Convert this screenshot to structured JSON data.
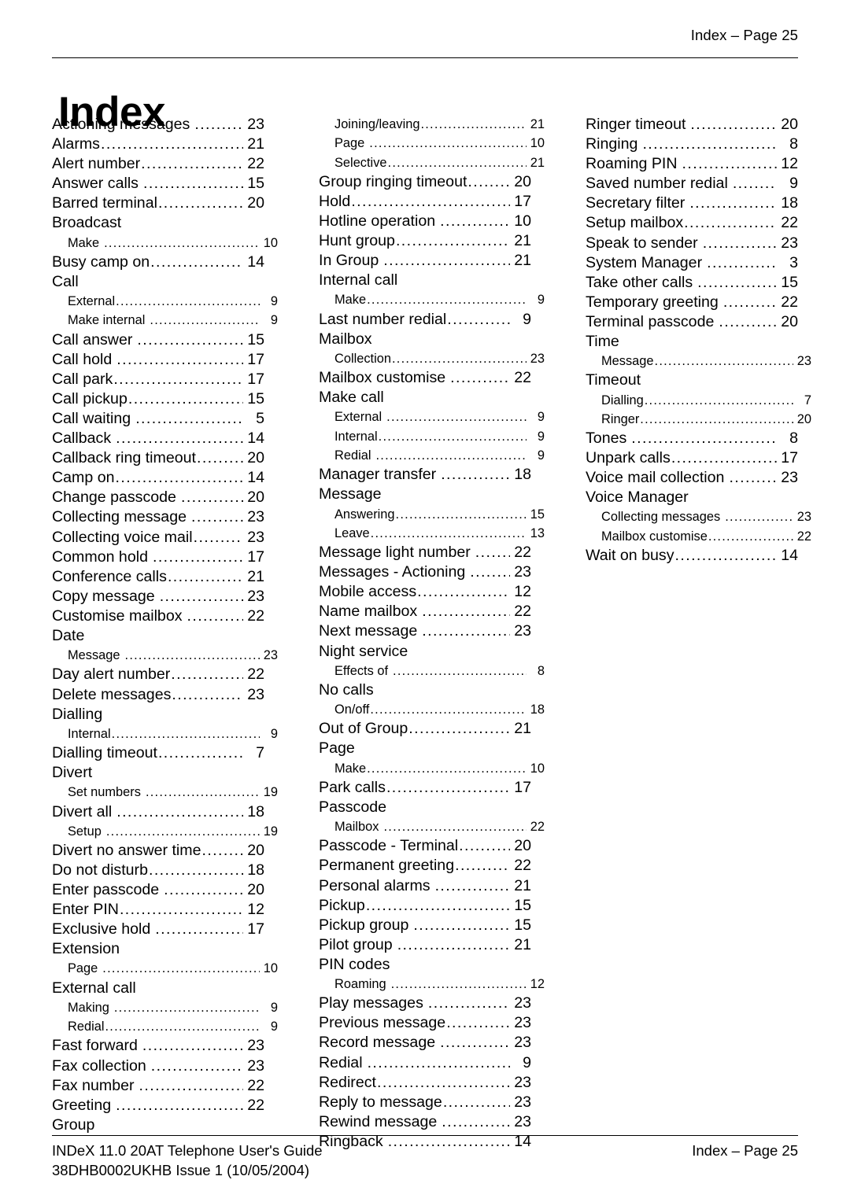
{
  "header": {
    "right_text": "Index – Page 25"
  },
  "title": "Index",
  "footer": {
    "line1": "INDeX 11.0 20AT Telephone User's Guide",
    "line2": "38DHB0002UKHB Issue 1 (10/05/2004)",
    "right_text": "Index – Page 25"
  },
  "columns": [
    {
      "name": "column-1",
      "entries": [
        {
          "label": "Actioning messages",
          "page": "23",
          "level": "main",
          "spaced": true
        },
        {
          "label": "Alarms",
          "page": "21",
          "level": "main",
          "spaced": false
        },
        {
          "label": "Alert number",
          "page": "22",
          "level": "main",
          "spaced": false
        },
        {
          "label": "Answer calls",
          "page": "15",
          "level": "main",
          "spaced": true
        },
        {
          "label": "Barred terminal",
          "page": "20",
          "level": "main",
          "spaced": false
        },
        {
          "label": "Broadcast",
          "page": "",
          "level": "heading",
          "spaced": false
        },
        {
          "label": "Make",
          "page": "10",
          "level": "sub",
          "spaced": true
        },
        {
          "label": "Busy camp on",
          "page": "14",
          "level": "main",
          "spaced": false
        },
        {
          "label": "Call",
          "page": "",
          "level": "heading",
          "spaced": false
        },
        {
          "label": "External",
          "page": "9",
          "level": "sub",
          "spaced": false
        },
        {
          "label": "Make internal",
          "page": "9",
          "level": "sub",
          "spaced": true
        },
        {
          "label": "Call answer",
          "page": "15",
          "level": "main",
          "spaced": true
        },
        {
          "label": "Call hold",
          "page": "17",
          "level": "main",
          "spaced": true
        },
        {
          "label": "Call park",
          "page": "17",
          "level": "main",
          "spaced": false
        },
        {
          "label": "Call pickup",
          "page": "15",
          "level": "main",
          "spaced": false
        },
        {
          "label": "Call waiting",
          "page": "5",
          "level": "main",
          "spaced": true
        },
        {
          "label": "Callback",
          "page": "14",
          "level": "main",
          "spaced": true
        },
        {
          "label": "Callback ring timeout",
          "page": "20",
          "level": "main",
          "spaced": false
        },
        {
          "label": "Camp on",
          "page": "14",
          "level": "main",
          "spaced": false
        },
        {
          "label": "Change passcode",
          "page": "20",
          "level": "main",
          "spaced": true
        },
        {
          "label": "Collecting message",
          "page": "23",
          "level": "main",
          "spaced": true
        },
        {
          "label": "Collecting voice mail",
          "page": "23",
          "level": "main",
          "spaced": false
        },
        {
          "label": "Common hold",
          "page": "17",
          "level": "main",
          "spaced": true
        },
        {
          "label": "Conference calls",
          "page": "21",
          "level": "main",
          "spaced": false
        },
        {
          "label": "Copy message",
          "page": "23",
          "level": "main",
          "spaced": true
        },
        {
          "label": "Customise mailbox",
          "page": "22",
          "level": "main",
          "spaced": true
        },
        {
          "label": "Date",
          "page": "",
          "level": "heading",
          "spaced": false
        },
        {
          "label": "Message",
          "page": "23",
          "level": "sub",
          "spaced": true
        },
        {
          "label": "Day alert number",
          "page": "22",
          "level": "main",
          "spaced": false
        },
        {
          "label": "Delete messages",
          "page": "23",
          "level": "main",
          "spaced": false
        },
        {
          "label": "Dialling",
          "page": "",
          "level": "heading",
          "spaced": false
        },
        {
          "label": "Internal",
          "page": "9",
          "level": "sub",
          "spaced": false
        },
        {
          "label": "Dialling timeout",
          "page": "7",
          "level": "main",
          "spaced": false
        },
        {
          "label": "Divert",
          "page": "",
          "level": "heading",
          "spaced": false
        },
        {
          "label": "Set numbers",
          "page": "19",
          "level": "sub",
          "spaced": true
        },
        {
          "label": "Divert all",
          "page": "18",
          "level": "main",
          "spaced": true
        },
        {
          "label": "Setup",
          "page": "19",
          "level": "sub",
          "spaced": true
        },
        {
          "label": "Divert no answer time",
          "page": "20",
          "level": "main",
          "spaced": false
        },
        {
          "label": "Do not disturb",
          "page": "18",
          "level": "main",
          "spaced": false
        },
        {
          "label": "Enter passcode",
          "page": "20",
          "level": "main",
          "spaced": true
        },
        {
          "label": "Enter PIN",
          "page": "12",
          "level": "main",
          "spaced": false
        },
        {
          "label": "Exclusive hold",
          "page": "17",
          "level": "main",
          "spaced": true
        },
        {
          "label": "Extension",
          "page": "",
          "level": "heading",
          "spaced": false
        },
        {
          "label": "Page",
          "page": "10",
          "level": "sub",
          "spaced": true
        },
        {
          "label": "External call",
          "page": "",
          "level": "heading",
          "spaced": false
        },
        {
          "label": "Making",
          "page": "9",
          "level": "sub",
          "spaced": true
        },
        {
          "label": "Redial",
          "page": "9",
          "level": "sub",
          "spaced": false
        },
        {
          "label": "Fast forward",
          "page": "23",
          "level": "main",
          "spaced": true
        },
        {
          "label": "Fax collection",
          "page": "23",
          "level": "main",
          "spaced": true
        },
        {
          "label": "Fax number",
          "page": "22",
          "level": "main",
          "spaced": true
        },
        {
          "label": "Greeting",
          "page": "22",
          "level": "main",
          "spaced": true
        },
        {
          "label": "Group",
          "page": "",
          "level": "heading",
          "spaced": false
        }
      ]
    },
    {
      "name": "column-2",
      "entries": [
        {
          "label": "Joining/leaving",
          "page": "21",
          "level": "sub",
          "spaced": false
        },
        {
          "label": "Page",
          "page": "10",
          "level": "sub",
          "spaced": true
        },
        {
          "label": "Selective",
          "page": "21",
          "level": "sub",
          "spaced": false
        },
        {
          "label": "Group ringing timeout",
          "page": "20",
          "level": "main",
          "spaced": false
        },
        {
          "label": "Hold",
          "page": "17",
          "level": "main",
          "spaced": false
        },
        {
          "label": "Hotline operation",
          "page": "10",
          "level": "main",
          "spaced": true
        },
        {
          "label": "Hunt group",
          "page": "21",
          "level": "main",
          "spaced": false
        },
        {
          "label": "In Group",
          "page": "21",
          "level": "main",
          "spaced": true
        },
        {
          "label": "Internal call",
          "page": "",
          "level": "heading",
          "spaced": false
        },
        {
          "label": "Make",
          "page": "9",
          "level": "sub",
          "spaced": false
        },
        {
          "label": "Last number redial",
          "page": "9",
          "level": "main",
          "spaced": false
        },
        {
          "label": "Mailbox",
          "page": "",
          "level": "heading",
          "spaced": false
        },
        {
          "label": "Collection",
          "page": "23",
          "level": "sub",
          "spaced": false
        },
        {
          "label": "Mailbox customise",
          "page": "22",
          "level": "main",
          "spaced": true
        },
        {
          "label": "Make call",
          "page": "",
          "level": "heading",
          "spaced": false
        },
        {
          "label": "External",
          "page": "9",
          "level": "sub",
          "spaced": true
        },
        {
          "label": "Internal",
          "page": "9",
          "level": "sub",
          "spaced": false
        },
        {
          "label": "Redial",
          "page": "9",
          "level": "sub",
          "spaced": true
        },
        {
          "label": "Manager transfer",
          "page": "18",
          "level": "main",
          "spaced": true
        },
        {
          "label": "Message",
          "page": "",
          "level": "heading",
          "spaced": false
        },
        {
          "label": "Answering",
          "page": "15",
          "level": "sub",
          "spaced": false
        },
        {
          "label": "Leave",
          "page": "13",
          "level": "sub",
          "spaced": false
        },
        {
          "label": "Message light number",
          "page": "22",
          "level": "main",
          "spaced": true
        },
        {
          "label": "Messages - Actioning",
          "page": "23",
          "level": "main",
          "spaced": true
        },
        {
          "label": "Mobile access",
          "page": "12",
          "level": "main",
          "spaced": false
        },
        {
          "label": "Name mailbox",
          "page": "22",
          "level": "main",
          "spaced": true
        },
        {
          "label": "Next message",
          "page": "23",
          "level": "main",
          "spaced": true
        },
        {
          "label": "Night service",
          "page": "",
          "level": "heading",
          "spaced": false
        },
        {
          "label": "Effects of",
          "page": "8",
          "level": "sub",
          "spaced": true
        },
        {
          "label": "No calls",
          "page": "",
          "level": "heading",
          "spaced": false
        },
        {
          "label": "On/off",
          "page": "18",
          "level": "sub",
          "spaced": false
        },
        {
          "label": "Out of Group",
          "page": "21",
          "level": "main",
          "spaced": false
        },
        {
          "label": "Page",
          "page": "",
          "level": "heading",
          "spaced": false
        },
        {
          "label": "Make",
          "page": "10",
          "level": "sub",
          "spaced": false
        },
        {
          "label": "Park calls",
          "page": "17",
          "level": "main",
          "spaced": false
        },
        {
          "label": "Passcode",
          "page": "",
          "level": "heading",
          "spaced": false
        },
        {
          "label": "Mailbox",
          "page": "22",
          "level": "sub",
          "spaced": true
        },
        {
          "label": "Passcode - Terminal",
          "page": "20",
          "level": "main",
          "spaced": false
        },
        {
          "label": "Permanent greeting",
          "page": "22",
          "level": "main",
          "spaced": false
        },
        {
          "label": "Personal alarms",
          "page": "21",
          "level": "main",
          "spaced": true
        },
        {
          "label": "Pickup",
          "page": "15",
          "level": "main",
          "spaced": false
        },
        {
          "label": "Pickup group",
          "page": "15",
          "level": "main",
          "spaced": true
        },
        {
          "label": "Pilot group",
          "page": "21",
          "level": "main",
          "spaced": true
        },
        {
          "label": "PIN codes",
          "page": "",
          "level": "heading",
          "spaced": false
        },
        {
          "label": "Roaming",
          "page": "12",
          "level": "sub",
          "spaced": true
        },
        {
          "label": "Play messages",
          "page": "23",
          "level": "main",
          "spaced": true
        },
        {
          "label": "Previous message",
          "page": "23",
          "level": "main",
          "spaced": false
        },
        {
          "label": "Record message",
          "page": "23",
          "level": "main",
          "spaced": true
        },
        {
          "label": "Redial",
          "page": "9",
          "level": "main",
          "spaced": true
        },
        {
          "label": "Redirect",
          "page": "23",
          "level": "main",
          "spaced": false
        },
        {
          "label": "Reply to message",
          "page": "23",
          "level": "main",
          "spaced": false
        },
        {
          "label": "Rewind message",
          "page": "23",
          "level": "main",
          "spaced": true
        },
        {
          "label": "Ringback",
          "page": "14",
          "level": "main",
          "spaced": true
        }
      ]
    },
    {
      "name": "column-3",
      "entries": [
        {
          "label": "Ringer timeout",
          "page": "20",
          "level": "main",
          "spaced": true
        },
        {
          "label": "Ringing",
          "page": "8",
          "level": "main",
          "spaced": true
        },
        {
          "label": "Roaming PIN",
          "page": "12",
          "level": "main",
          "spaced": true
        },
        {
          "label": "Saved number redial",
          "page": "9",
          "level": "main",
          "spaced": true
        },
        {
          "label": "Secretary filter",
          "page": "18",
          "level": "main",
          "spaced": true
        },
        {
          "label": "Setup mailbox",
          "page": "22",
          "level": "main",
          "spaced": false
        },
        {
          "label": "Speak to sender",
          "page": "23",
          "level": "main",
          "spaced": true
        },
        {
          "label": "System Manager",
          "page": "3",
          "level": "main",
          "spaced": true
        },
        {
          "label": "Take other calls",
          "page": "15",
          "level": "main",
          "spaced": true
        },
        {
          "label": "Temporary greeting",
          "page": "22",
          "level": "main",
          "spaced": true
        },
        {
          "label": "Terminal passcode",
          "page": "20",
          "level": "main",
          "spaced": true
        },
        {
          "label": "Time",
          "page": "",
          "level": "heading",
          "spaced": false
        },
        {
          "label": "Message",
          "page": "23",
          "level": "sub",
          "spaced": false
        },
        {
          "label": "Timeout",
          "page": "",
          "level": "heading",
          "spaced": false
        },
        {
          "label": "Dialling",
          "page": "7",
          "level": "sub",
          "spaced": false
        },
        {
          "label": "Ringer",
          "page": "20",
          "level": "sub",
          "spaced": false
        },
        {
          "label": "Tones",
          "page": "8",
          "level": "main",
          "spaced": true
        },
        {
          "label": "Unpark calls",
          "page": "17",
          "level": "main",
          "spaced": false
        },
        {
          "label": "Voice mail collection",
          "page": "23",
          "level": "main",
          "spaced": true
        },
        {
          "label": "Voice Manager",
          "page": "",
          "level": "heading",
          "spaced": false
        },
        {
          "label": "Collecting messages",
          "page": "23",
          "level": "sub",
          "spaced": true
        },
        {
          "label": "Mailbox customise",
          "page": "22",
          "level": "sub",
          "spaced": false
        },
        {
          "label": "Wait on busy",
          "page": "14",
          "level": "main",
          "spaced": false
        }
      ]
    }
  ]
}
